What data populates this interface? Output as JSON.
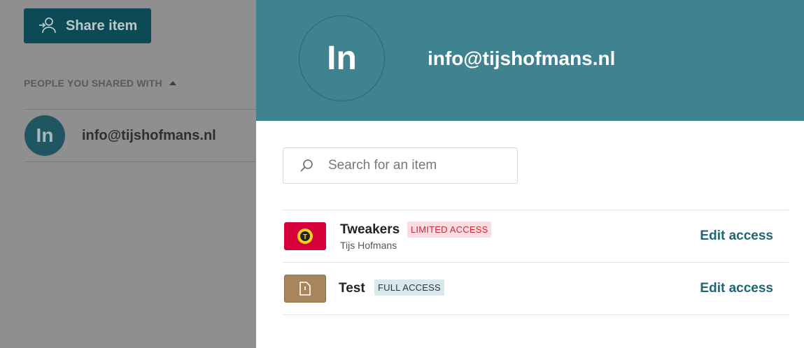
{
  "left_panel": {
    "share_button_label": "Share item",
    "section_label": "PEOPLE YOU SHARED WITH",
    "shared_user": {
      "initials": "In",
      "email": "info@tijshofmans.nl"
    }
  },
  "drawer": {
    "header": {
      "initials": "In",
      "email": "info@tijshofmans.nl"
    },
    "search": {
      "placeholder": "Search for an item",
      "value": ""
    },
    "items": [
      {
        "name": "Tweakers",
        "subtitle": "Tijs Hofmans",
        "access": "LIMITED ACCESS",
        "action": "Edit access",
        "icon": "tweakers-logo-icon",
        "icon_color": "#d6003a"
      },
      {
        "name": "Test",
        "subtitle": "",
        "access": "FULL ACCESS",
        "action": "Edit access",
        "icon": "document-icon",
        "icon_color": "#a8855a"
      }
    ]
  },
  "colors": {
    "header_bg": "#3f8290",
    "primary_dark": "#0c4a56",
    "link": "#1e6672",
    "limited_bg": "#f9dde0",
    "limited_text": "#c8283a",
    "full_bg": "#d9e8ec"
  }
}
